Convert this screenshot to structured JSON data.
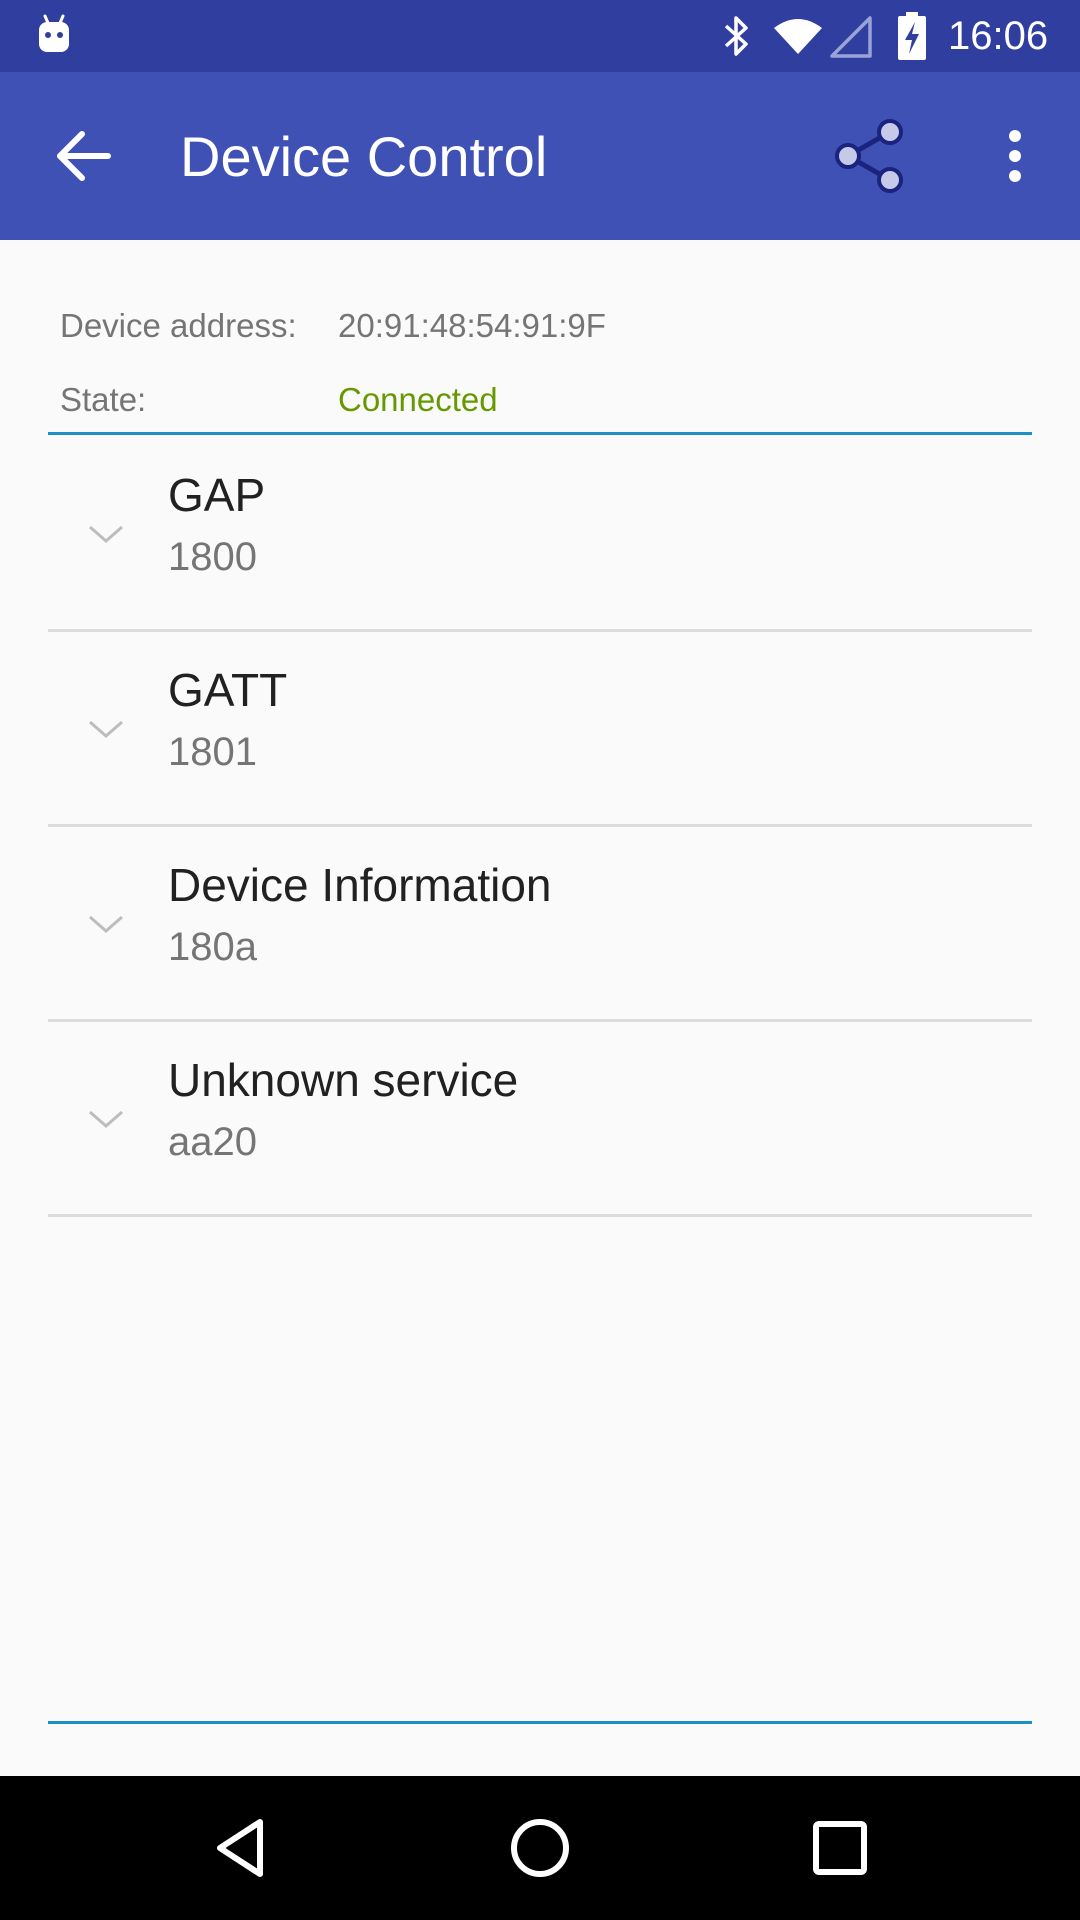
{
  "status_bar": {
    "time": "16:06",
    "icons": [
      "android-notification-icon",
      "bluetooth-icon",
      "wifi-icon",
      "cell-signal-icon",
      "battery-charging-icon"
    ],
    "color": "#303f9f"
  },
  "app_bar": {
    "title": "Device Control",
    "back_icon": "arrow-back-icon",
    "share_icon": "share-icon",
    "overflow_icon": "more-vert-icon",
    "color": "#3f51b5"
  },
  "device_info": {
    "address_label": "Device address:",
    "address_value": "20:91:48:54:91:9F",
    "state_label": "State:",
    "state_value": "Connected",
    "state_color": "#669900"
  },
  "services": [
    {
      "name": "GAP",
      "uuid": "1800"
    },
    {
      "name": "GATT",
      "uuid": "1801"
    },
    {
      "name": "Device Information",
      "uuid": "180a"
    },
    {
      "name": "Unknown service",
      "uuid": "aa20"
    }
  ],
  "colors": {
    "accent_line": "#1e8fc6",
    "divider": "#dcdcdc",
    "background": "#fafafa"
  },
  "nav_bar": {
    "buttons": [
      "back-triangle-icon",
      "home-circle-icon",
      "recents-square-icon"
    ]
  }
}
